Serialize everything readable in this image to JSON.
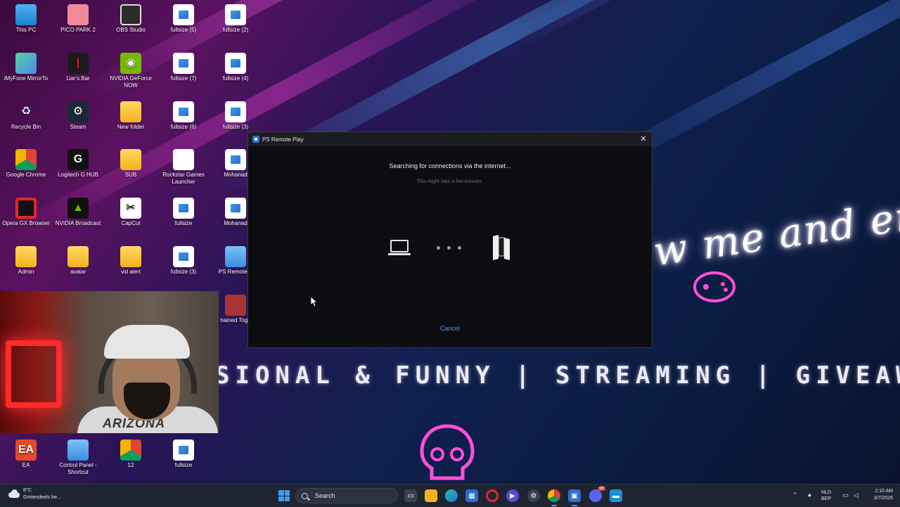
{
  "desktop": {
    "icons": [
      {
        "label": "This PC",
        "icon": "pc-icon"
      },
      {
        "label": "PICO PARK 2",
        "icon": "game-icon"
      },
      {
        "label": "OBS Studio",
        "icon": "obs-icon"
      },
      {
        "label": "fullsize (5)",
        "icon": "image-shortcut-icon"
      },
      {
        "label": "fullsize (2)",
        "icon": "image-shortcut-icon"
      },
      {
        "label": "iMyFone MirrorTo",
        "icon": "mirror-app-icon"
      },
      {
        "label": "Liar's Bar",
        "icon": "game-icon"
      },
      {
        "label": "NVIDIA GeForce NOW",
        "icon": "nvidia-icon"
      },
      {
        "label": "fullsize (7)",
        "icon": "image-shortcut-icon"
      },
      {
        "label": "fullsize (4)",
        "icon": "image-shortcut-icon"
      },
      {
        "label": "Recycle Bin",
        "icon": "recycle-bin-icon"
      },
      {
        "label": "Steam",
        "icon": "steam-icon"
      },
      {
        "label": "New folder",
        "icon": "folder-icon"
      },
      {
        "label": "fullsize (6)",
        "icon": "image-shortcut-icon"
      },
      {
        "label": "fullsize (3)",
        "icon": "image-shortcut-icon"
      },
      {
        "label": "Google Chrome",
        "icon": "chrome-icon"
      },
      {
        "label": "Logitech G HUB",
        "icon": "logitech-icon"
      },
      {
        "label": "SUB",
        "icon": "folder-icon"
      },
      {
        "label": "Rockstar Games Launcher",
        "icon": "document-icon"
      },
      {
        "label": "Mohanad",
        "icon": "image-shortcut-icon"
      },
      {
        "label": "Opera GX Browser",
        "icon": "opera-icon"
      },
      {
        "label": "NVIDIA Broadcast",
        "icon": "nvidia-broadcast-icon"
      },
      {
        "label": "CapCut",
        "icon": "capcut-icon"
      },
      {
        "label": "fullsize",
        "icon": "image-shortcut-icon"
      },
      {
        "label": "Mohanad",
        "icon": "image-shortcut-icon"
      },
      {
        "label": "Admin",
        "icon": "folder-icon"
      },
      {
        "label": "avatar",
        "icon": "folder-icon"
      },
      {
        "label": "vid alert",
        "icon": "folder-icon"
      },
      {
        "label": "fullsize (3)",
        "icon": "image-shortcut-icon"
      },
      {
        "label": "PS Remote P",
        "icon": "ps-remote-play-icon"
      },
      {
        "label": "hained Toge",
        "icon": "game-icon"
      },
      {
        "label": "EA",
        "icon": "ea-icon"
      },
      {
        "label": "Control Panel - Shortcut",
        "icon": "control-panel-icon"
      },
      {
        "label": "12",
        "icon": "chrome-icon"
      },
      {
        "label": "fullsize",
        "icon": "image-shortcut-icon"
      }
    ]
  },
  "wallpaper": {
    "script_text": "w me and en",
    "banner_text": "SIONAL & FUNNY | STREAMING | GIVEAWAY"
  },
  "webcam": {
    "shirt_text": "ARIZONA"
  },
  "dialog": {
    "title": "PS Remote Play",
    "heading": "Searching for connections via the internet...",
    "subtext": "This might take a few minutes.",
    "cancel_label": "Cancel",
    "accent_color": "#4c9cff"
  },
  "taskbar": {
    "weather_temp": "8°C",
    "weather_desc": "Grotendeels be...",
    "search_placeholder": "Search",
    "apps": [
      "task-view-icon",
      "file-explorer-icon",
      "edge-icon",
      "store-icon",
      "opera-gx-icon",
      "media-app-icon",
      "game-overlay-icon",
      "chrome-icon",
      "ps-remote-play-icon",
      "discord-icon",
      "remote-desktop-icon"
    ],
    "discord_badge": "99",
    "lang_top": "NLD",
    "lang_bottom": "BEP",
    "time": "2:10 AM",
    "date": "3/7/2026"
  }
}
